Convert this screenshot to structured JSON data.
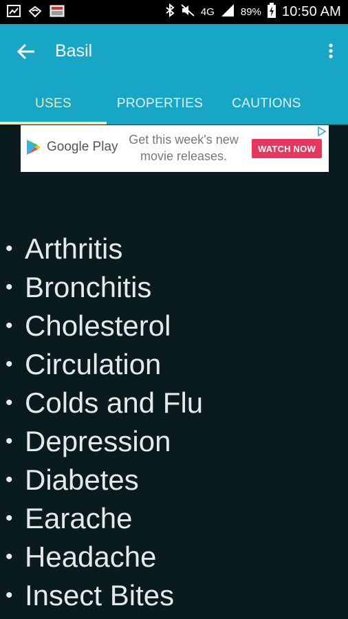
{
  "status_bar": {
    "battery_percent": "89%",
    "network_label": "4G",
    "time": "10:50 AM",
    "icons": [
      "chart-icon",
      "wifi-icon",
      "app-notification-icon",
      "bluetooth-icon",
      "mute-icon",
      "signal-icon",
      "battery-charging-icon"
    ]
  },
  "app_bar": {
    "title": "Basil",
    "back_icon": "arrow-left-icon",
    "overflow_icon": "more-vertical-icon",
    "background": "#18a6c6"
  },
  "tabs": [
    {
      "label": "USES",
      "active": true
    },
    {
      "label": "PROPERTIES",
      "active": false
    },
    {
      "label": "CAUTIONS",
      "active": false
    }
  ],
  "ad": {
    "brand": "Google Play",
    "copy_line1": "Get this week's new",
    "copy_line2": "movie releases.",
    "button": "WATCH NOW",
    "button_color": "#e8365d"
  },
  "uses": [
    "Arthritis",
    "Bronchitis",
    "Cholesterol",
    "Circulation",
    "Colds and Flu",
    "Depression",
    "Diabetes",
    "Earache",
    "Headache",
    "Insect Bites"
  ]
}
